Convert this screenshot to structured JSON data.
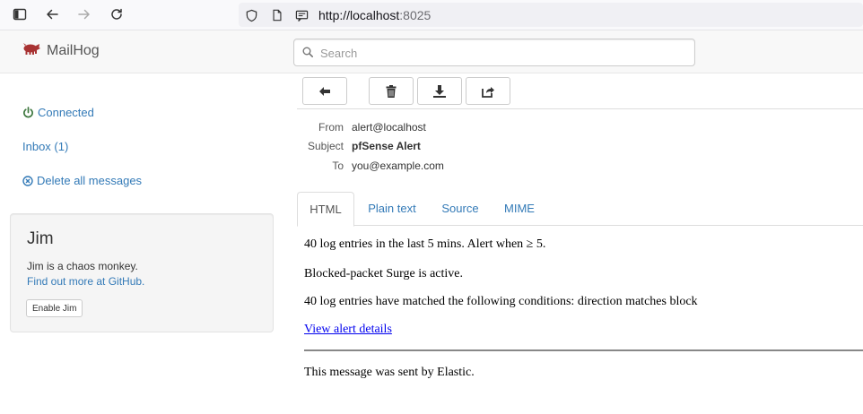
{
  "browser": {
    "url_host": "http://localhost",
    "url_port": ":8025"
  },
  "app": {
    "brand": "MailHog"
  },
  "search": {
    "placeholder": "Search"
  },
  "sidebar": {
    "connected": "Connected",
    "inbox": "Inbox (1)",
    "delete_all": "Delete all messages"
  },
  "jim": {
    "title": "Jim",
    "description": "Jim is a chaos monkey.",
    "link": "Find out more at GitHub.",
    "button": "Enable Jim"
  },
  "message": {
    "from_label": "From",
    "from": "alert@localhost",
    "subject_label": "Subject",
    "subject": "pfSense Alert",
    "to_label": "To",
    "to": "you@example.com"
  },
  "tabs": [
    "HTML",
    "Plain text",
    "Source",
    "MIME"
  ],
  "body": {
    "line1": "40 log entries in the last 5 mins. Alert when ≥ 5.",
    "line2": "Blocked-packet Surge is active.",
    "line3": "40 log entries have matched the following conditions: direction matches block",
    "link": "View alert details",
    "footer": "This message was sent by Elastic."
  },
  "colors": {
    "link": "#337ab7",
    "connected": "#3c763d",
    "brand_logo": "#a83232"
  }
}
